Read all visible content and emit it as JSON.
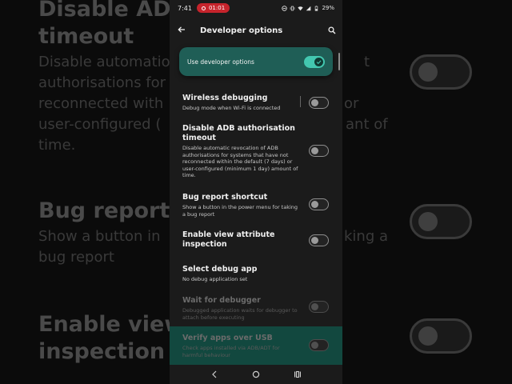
{
  "status_bar": {
    "time": "7:41",
    "recording": "01:01",
    "battery": "29%"
  },
  "app_bar": {
    "title": "Developer options"
  },
  "master_switch": {
    "label": "Use developer options",
    "state": "on"
  },
  "clipped_item": {
    "title": "authorisations"
  },
  "settings": [
    {
      "title": "Wireless debugging",
      "desc": "Debug mode when Wi-Fi is connected",
      "state": "off",
      "enabled": true
    },
    {
      "title": "Disable ADB authorisation timeout",
      "desc": "Disable automatic revocation of ADB authorisations for systems that have not reconnected within the default (7 days) or user-configured (minimum 1 day) amount of time.",
      "state": "off",
      "enabled": true
    },
    {
      "title": "Bug report shortcut",
      "desc": "Show a button in the power menu for taking a bug report",
      "state": "off",
      "enabled": true
    },
    {
      "title": "Enable view attribute inspection",
      "desc": "",
      "state": "off",
      "enabled": true
    },
    {
      "title": "Select debug app",
      "desc": "No debug application set",
      "enabled": true
    },
    {
      "title": "Wait for debugger",
      "desc": "Debugged application waits for debugger to attach before executing",
      "state": "off",
      "enabled": false
    },
    {
      "title": "Verify apps over USB",
      "desc": "Check apps installed via ADB/ADT for harmful behaviour",
      "state": "off",
      "enabled": false
    }
  ],
  "background": {
    "line1": "Disable ADB",
    "line2": "timeout",
    "desc1": "Disable automatio",
    "desc1b": "t",
    "desc2": "authorisations for",
    "desc3": "reconnected with",
    "desc3b": "or",
    "desc4": "user-configured (",
    "desc4b": "ant of",
    "desc5": "time.",
    "bug_title": "Bug report",
    "bug_desc1": "Show a button in",
    "bug_desc1b": "king a",
    "bug_desc2": "bug report",
    "view_line1": "Enable view",
    "view_line2": "inspection"
  },
  "colors": {
    "accent": "#43c7b0",
    "master_bg": "#1f5e56",
    "recording": "#c6242c"
  }
}
